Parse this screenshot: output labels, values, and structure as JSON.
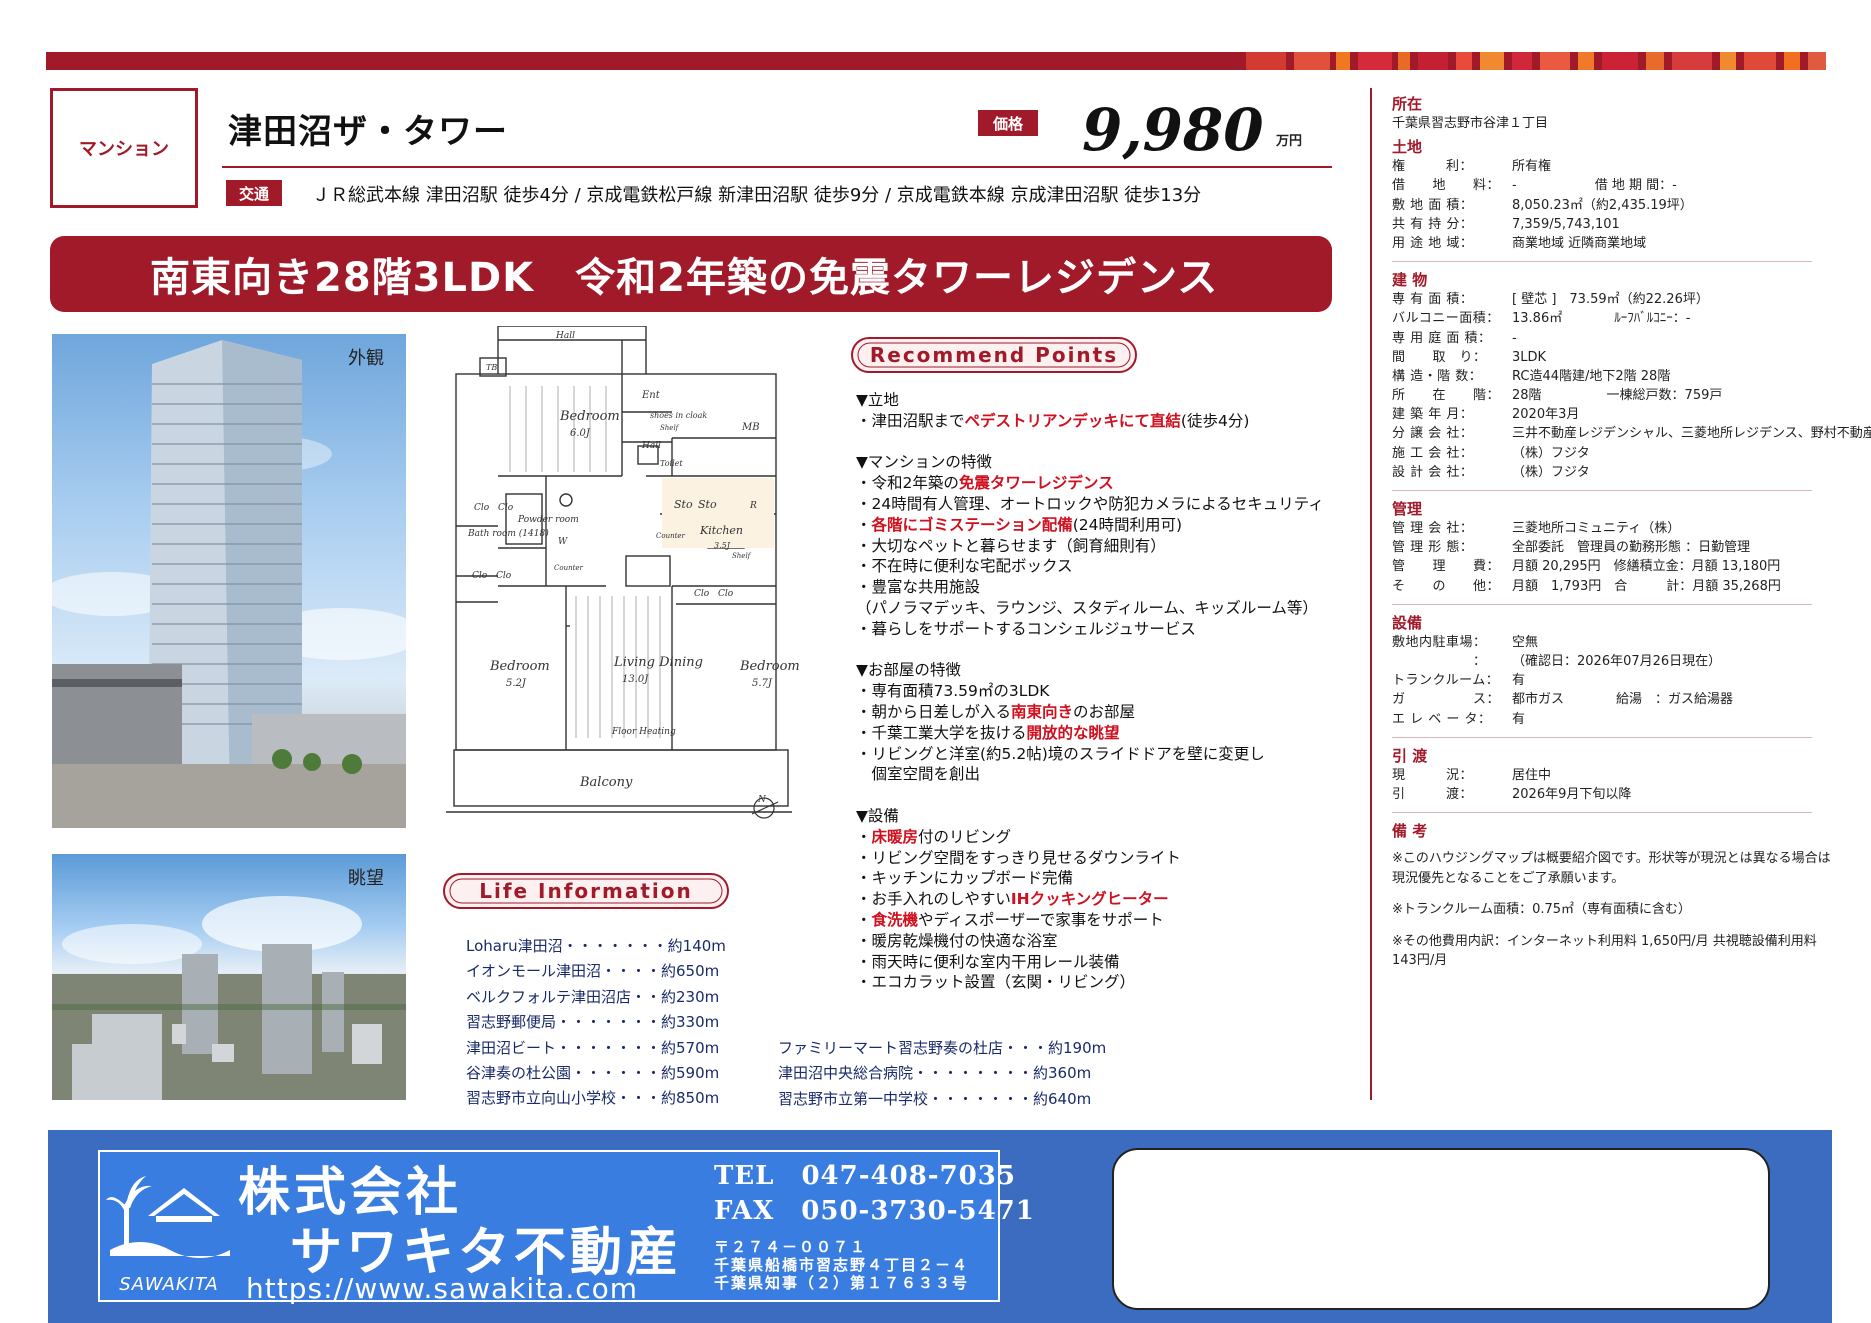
{
  "header": {
    "type_label": "マンション",
    "property_name": "津田沼ザ・タワー",
    "price_label": "価格",
    "price_value": "9,980",
    "price_unit": "万円",
    "traffic_label": "交通",
    "traffic_text": "ＪＲ総武本線 津田沼駅 徒歩4分 / 京成電鉄松戸線 新津田沼駅 徒歩9分 / 京成電鉄本線 京成津田沼駅 徒歩13分"
  },
  "banner": {
    "headline": "南東向き28階3LDK　令和2年築の免震タワーレジデンス"
  },
  "photos": {
    "exterior_caption": "外観",
    "view_caption": "眺望"
  },
  "floorplan": {
    "labels": [
      "Hall",
      "TB",
      "Bedroom",
      "6.0J",
      "Ent",
      "shoes in cloak",
      "Shelf",
      "Hall",
      "Toilet",
      "MB",
      "Clo",
      "Clo",
      "Bath room (1418)",
      "Powder room",
      "W",
      "Sto",
      "Sto",
      "R",
      "Kitchen",
      "3.5J",
      "Counter",
      "Shelf",
      "Clo",
      "Clo",
      "Clo",
      "Clo",
      "Counter",
      "Bedroom",
      "5.2J",
      "Living Dining",
      "13.0J",
      "Bedroom",
      "5.7J",
      "Floor Heating",
      "Balcony",
      "N"
    ]
  },
  "recommend": {
    "title": "Recommend Points",
    "lines": [
      [
        {
          "t": "▼立地"
        }
      ],
      [
        {
          "t": "・津田沼駅まで"
        },
        {
          "t": "ペデストリアンデッキにて直結",
          "r": true
        },
        {
          "t": "(徒歩4分)"
        }
      ],
      [],
      [
        {
          "t": "▼マンションの特徴"
        }
      ],
      [
        {
          "t": "・令和2年築の"
        },
        {
          "t": "免震タワーレジデンス",
          "r": true
        }
      ],
      [
        {
          "t": "・24時間有人管理、オートロックや防犯カメラによるセキュリティ"
        }
      ],
      [
        {
          "t": "・"
        },
        {
          "t": "各階にゴミステーション配備",
          "r": true
        },
        {
          "t": "(24時間利用可)"
        }
      ],
      [
        {
          "t": "・大切なペットと暮らせます（飼育細則有）"
        }
      ],
      [
        {
          "t": "・不在時に便利な宅配ボックス"
        }
      ],
      [
        {
          "t": "・豊富な共用施設"
        }
      ],
      [
        {
          "t": "（パノラマデッキ、ラウンジ、スタディルーム、キッズルーム等）"
        }
      ],
      [
        {
          "t": "・暮らしをサポートするコンシェルジュサービス"
        }
      ],
      [],
      [
        {
          "t": "▼お部屋の特徴"
        }
      ],
      [
        {
          "t": "・専有面積73.59㎡の3LDK"
        }
      ],
      [
        {
          "t": "・朝から日差しが入る"
        },
        {
          "t": "南東向き",
          "r": true
        },
        {
          "t": "のお部屋"
        }
      ],
      [
        {
          "t": "・千葉工業大学を抜ける"
        },
        {
          "t": "開放的な眺望",
          "r": true
        }
      ],
      [
        {
          "t": "・リビングと洋室(約5.2帖)境のスライドドアを壁に変更し"
        }
      ],
      [
        {
          "t": "　個室空間を創出"
        }
      ],
      [],
      [
        {
          "t": "▼設備"
        }
      ],
      [
        {
          "t": "・"
        },
        {
          "t": "床暖房",
          "r": true
        },
        {
          "t": "付のリビング"
        }
      ],
      [
        {
          "t": "・リビング空間をすっきり見せるダウンライト"
        }
      ],
      [
        {
          "t": "・キッチンにカップボード完備"
        }
      ],
      [
        {
          "t": "・お手入れのしやすい"
        },
        {
          "t": "IHクッキングヒーター",
          "r": true
        }
      ],
      [
        {
          "t": "・"
        },
        {
          "t": "食洗機",
          "r": true
        },
        {
          "t": "やディスポーザーで家事をサポート"
        }
      ],
      [
        {
          "t": "・暖房乾燥機付の快適な浴室"
        }
      ],
      [
        {
          "t": "・雨天時に便利な室内干用レール装備"
        }
      ],
      [
        {
          "t": "・エコカラット設置（玄関・リビング）"
        }
      ]
    ]
  },
  "life_info": {
    "title": "Life Information",
    "left": [
      "Loharu津田沼・・・・・・・約140m",
      "イオンモール津田沼・・・・約650m",
      "ベルクフォルテ津田沼店・・約230m",
      "習志野郵便局・・・・・・・約330m",
      "津田沼ビート・・・・・・・約570m",
      "谷津奏の杜公園・・・・・・約590m",
      "習志野市立向山小学校・・・約850m"
    ],
    "right": [
      "ファミリーマート習志野奏の杜店・・・約190m",
      "津田沼中央総合病院・・・・・・・・約360m",
      "習志野市立第一中学校・・・・・・・約640m"
    ]
  },
  "sidebar": {
    "location": {
      "title": "所在",
      "lines": [
        {
          "k": "",
          "v": "千葉県習志野市谷津１丁目"
        }
      ]
    },
    "land": {
      "title": "土地",
      "lines": [
        {
          "k": "権　　　利：",
          "v": "所有権"
        },
        {
          "k": "借　　地　　料：",
          "v": "-　　　　　　借 地 期 間：-"
        },
        {
          "k": "敷 地 面 積：",
          "v": "8,050.23㎡（約2,435.19坪）"
        },
        {
          "k": "共 有 持 分：",
          "v": "7,359/5,743,101"
        },
        {
          "k": "用 途 地 域：",
          "v": "商業地域 近隣商業地域"
        }
      ]
    },
    "building": {
      "title": "建 物",
      "lines": [
        {
          "k": "専 有 面 積：",
          "v": "[ 壁芯 ]　73.59㎡（約22.26坪）"
        },
        {
          "k": "バルコニー面積：",
          "v": "13.86㎡　　　　ﾙｰﾌﾊﾞﾙｺﾆｰ：-"
        },
        {
          "k": "専 用 庭 面 積：",
          "v": "-"
        },
        {
          "k": "間　　取　り：",
          "v": "3LDK"
        },
        {
          "k": "構 造・階 数：",
          "v": "RC造44階建/地下2階 28階"
        },
        {
          "k": "所　　在　　階：",
          "v": "28階　　　　　一棟総戸数：759戸"
        },
        {
          "k": "建 築 年 月：",
          "v": "2020年3月"
        },
        {
          "k": "分 譲 会 社：",
          "v": "三井不動産レジデンシャル、三菱地所レジデンス、野村不動産"
        },
        {
          "k": "施 工 会 社：",
          "v": "（株）フジタ"
        },
        {
          "k": "設 計 会 社：",
          "v": "（株）フジタ"
        }
      ]
    },
    "management": {
      "title": "管理",
      "lines": [
        {
          "k": "管 理 会 社：",
          "v": "三菱地所コミュニティ（株）"
        },
        {
          "k": "管 理 形 態：",
          "v": "全部委託　管理員の勤務形態 ：日勤管理"
        },
        {
          "k": "管　　理　　費：",
          "v": "月額 20,295円　修繕積立金：月額 13,180円"
        },
        {
          "k": "そ　　の　　他：",
          "v": "月額　1,793円　合　　　計：月額 35,268円"
        }
      ]
    },
    "facilities": {
      "title": "設備",
      "lines": [
        {
          "k": "敷地内駐車場：",
          "v": "空無"
        },
        {
          "k": "　　　　　　：",
          "v": "（確認日：2026年07月26日現在）"
        },
        {
          "k": "トランクルーム：",
          "v": "有"
        },
        {
          "k": "ガ　　　　　ス：",
          "v": "都市ガス　　　　給湯　：ガス給湯器"
        },
        {
          "k": "エ レ ベ ー タ：",
          "v": "有"
        }
      ]
    },
    "handover": {
      "title": "引 渡",
      "lines": [
        {
          "k": "現　　　況：",
          "v": "居住中"
        },
        {
          "k": "引　　　渡：",
          "v": "2026年9月下旬以降"
        }
      ]
    },
    "remarks": {
      "title": "備 考",
      "notes": [
        "※このハウジングマップは概要紹介図です。形状等が現況とは異なる場合は現況優先となることをご了承願います。",
        "※トランクルーム面積：0.75㎡（専有面積に含む）",
        "※その他費用内訳：インターネット利用料 1,650円/月 共視聴設備利用料143円/月"
      ]
    }
  },
  "footer": {
    "logo_text": "SAWAKITA",
    "company_line1": "株式会社",
    "company_line2": "サワキタ不動産",
    "url": "https://www.sawakita.com",
    "tel": "TEL　047-408-7035",
    "fax": "FAX　050-3730-5471",
    "postal": "〒２７４－００７１",
    "address": "千葉県船橋市習志野４丁目２－４",
    "license": "千葉県知事（２）第１７６３３号"
  },
  "colors": {
    "brand_red": "#a11a2a",
    "highlight_red": "#d0101e",
    "footer_blue": "#3b6cc0",
    "card_blue": "#3a7de0"
  }
}
